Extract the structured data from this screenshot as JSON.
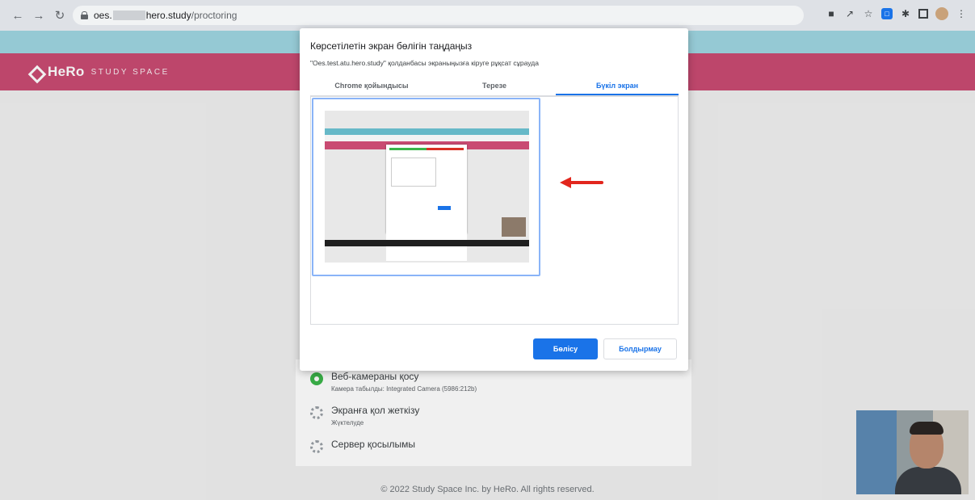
{
  "browser": {
    "url_prefix": "oes.",
    "url_host": "hero.study",
    "url_path": "/proctoring"
  },
  "page": {
    "logo_text": "HeRo",
    "logo_sub": "STUDY SPACE",
    "steps": [
      {
        "title": "Веб-камераны қосу",
        "sub": "Камера табылды: Integrated Camera (5986:212b)"
      },
      {
        "title": "Экранға қол жеткізу",
        "sub": "Жүктелуде"
      },
      {
        "title": "Сервер қосылымы",
        "sub": ""
      }
    ],
    "footer": "© 2022 Study Space Inc. by HeRo. All rights reserved."
  },
  "dialog": {
    "title": "Көрсетілетін экран бөлігін таңдаңыз",
    "subtitle": "\"Oes.test.atu.hero.study\" қолданбасы экраныңызға кіруге рұқсат сұрауда",
    "tabs": [
      {
        "label": "Chrome қойындысы",
        "active": false
      },
      {
        "label": "Терезе",
        "active": false
      },
      {
        "label": "Бүкіл экран",
        "active": true
      }
    ],
    "share_label": "Бөлісу",
    "cancel_label": "Болдырмау"
  },
  "colors": {
    "brand_pink": "#c94b72",
    "accent_blue": "#1a73e8",
    "arrow_red": "#e2261d"
  }
}
